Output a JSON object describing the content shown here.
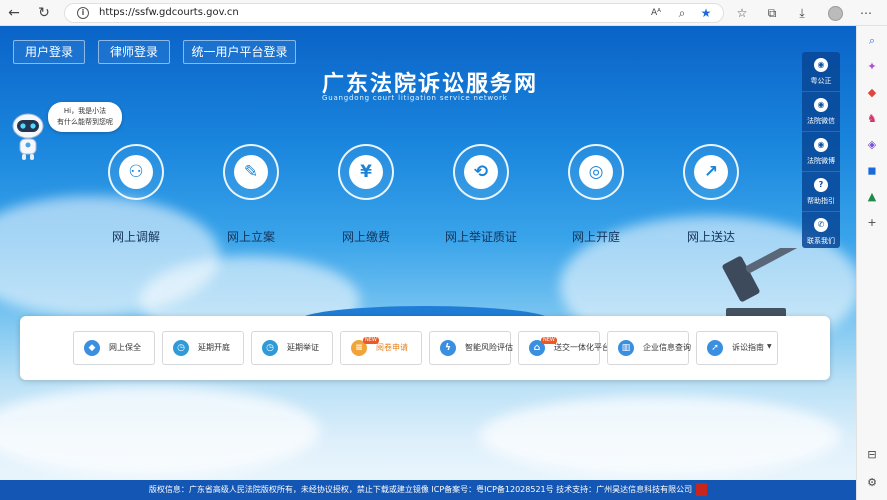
{
  "browser": {
    "url": "https://ssfw.gdcourts.gov.cn",
    "icons": [
      "back-icon",
      "refresh-icon",
      "info-icon",
      "read-aloud-icon",
      "zoom-icon",
      "favorite-star-icon",
      "favorites-icon",
      "collections-icon",
      "downloads-icon",
      "profile-icon",
      "more-icon"
    ]
  },
  "header": {
    "login_buttons": [
      "用户登录",
      "律师登录",
      "统一用户平台登录"
    ],
    "logo_title": "广东法院诉讼服务网",
    "logo_subtitle": "Guangdong court litigation service network"
  },
  "assistant": {
    "bubble_line1": "Hi，我是小法",
    "bubble_line2": "有什么能帮到您呢"
  },
  "services": [
    {
      "label": "网上调解",
      "icon": "mediation-icon",
      "glyph": "⚇"
    },
    {
      "label": "网上立案",
      "icon": "filing-icon",
      "glyph": "✎"
    },
    {
      "label": "网上缴费",
      "icon": "payment-icon",
      "glyph": "¥"
    },
    {
      "label": "网上举证质证",
      "icon": "evidence-icon",
      "glyph": "⟲"
    },
    {
      "label": "网上开庭",
      "icon": "online-court-icon",
      "glyph": "◎"
    },
    {
      "label": "网上送达",
      "icon": "delivery-icon",
      "glyph": "↗"
    }
  ],
  "side_panel": [
    {
      "label": "粤公正",
      "glyph": "◉"
    },
    {
      "label": "法院微信",
      "glyph": "◉"
    },
    {
      "label": "法院微博",
      "glyph": "◉"
    },
    {
      "label": "帮助指引",
      "glyph": "?"
    },
    {
      "label": "联系我们",
      "glyph": "✆"
    }
  ],
  "quick_links": [
    {
      "label": "网上保全",
      "color": "#3b8fe0",
      "glyph": "◆",
      "new": false
    },
    {
      "label": "延期开庭",
      "color": "#2f9ad8",
      "glyph": "◷",
      "new": false
    },
    {
      "label": "延期举证",
      "color": "#2f9ad8",
      "glyph": "◷",
      "new": false
    },
    {
      "label": "阅卷申请",
      "color": "#f2a43a",
      "glyph": "≡",
      "new": true,
      "highlight": "#e6801a"
    },
    {
      "label": "智能风险评估",
      "color": "#3b8fe0",
      "glyph": "ϟ",
      "new": false
    },
    {
      "label": "送交一体化平台",
      "color": "#3b8fe0",
      "glyph": "⌂",
      "new": true
    },
    {
      "label": "企业信息查询",
      "color": "#3b8fe0",
      "glyph": "▥",
      "new": false
    },
    {
      "label": "诉讼指南",
      "color": "#3b8fe0",
      "glyph": "➚",
      "new": false,
      "dropdown": true
    }
  ],
  "new_badge": "NEW",
  "footer": {
    "text": "版权信息：广东省高级人民法院版权所有，未经协议授权，禁止下载或建立镜像 ICP备案号：粤ICP备12028521号 技术支持：广州昊达信息科技有限公司"
  },
  "colors": {
    "brand_blue": "#1456b4",
    "accent_orange": "#e6801a"
  }
}
